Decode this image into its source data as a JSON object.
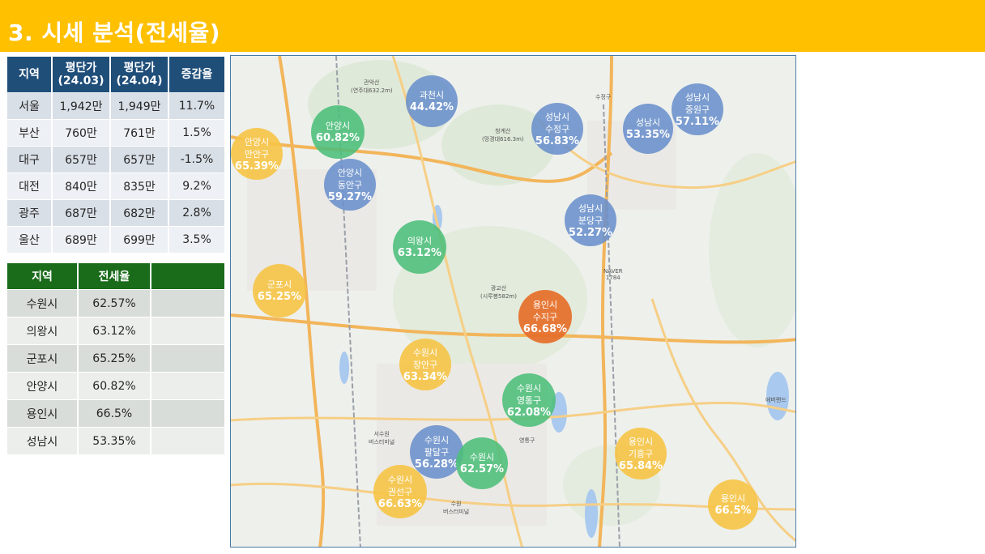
{
  "header": {
    "title": "3. 시세 분석(전세율)"
  },
  "price_table": {
    "headers": [
      "지역",
      "평단가\n(24.03)",
      "평단가\n(24.04)",
      "증감율"
    ],
    "rows": [
      [
        "서울",
        "1,942만",
        "1,949만",
        "11.7%"
      ],
      [
        "부산",
        "760만",
        "761만",
        "1.5%"
      ],
      [
        "대구",
        "657만",
        "657만",
        "-1.5%"
      ],
      [
        "대전",
        "840만",
        "835만",
        "9.2%"
      ],
      [
        "광주",
        "687만",
        "682만",
        "2.8%"
      ],
      [
        "울산",
        "689만",
        "699만",
        "3.5%"
      ]
    ]
  },
  "jeonse_table": {
    "headers": [
      "지역",
      "전세율",
      ""
    ],
    "rows": [
      [
        "수원시",
        "62.57%",
        ""
      ],
      [
        "의왕시",
        "63.12%",
        ""
      ],
      [
        "군포시",
        "65.25%",
        ""
      ],
      [
        "안양시",
        "60.82%",
        ""
      ],
      [
        "용인시",
        "66.5%",
        ""
      ],
      [
        "성남시",
        "53.35%",
        ""
      ]
    ]
  },
  "map": {
    "colors": {
      "blue": "#6a8fcc",
      "green": "#4cbe7a",
      "yellow": "#f6c446",
      "orange": "#e66e28"
    },
    "bubbles": [
      {
        "name": "과천시",
        "value": "44.42%",
        "color": "blue"
      },
      {
        "name": "성남시\n중원구",
        "value": "57.11%",
        "color": "blue"
      },
      {
        "name": "성남시\n수정구",
        "value": "56.83%",
        "color": "blue"
      },
      {
        "name": "성남시",
        "value": "53.35%",
        "color": "blue"
      },
      {
        "name": "안양시",
        "value": "60.82%",
        "color": "green"
      },
      {
        "name": "안양시\n만안구",
        "value": "65.39%",
        "color": "yellow"
      },
      {
        "name": "안양시\n동안구",
        "value": "59.27%",
        "color": "blue"
      },
      {
        "name": "성남시\n분당구",
        "value": "52.27%",
        "color": "blue"
      },
      {
        "name": "의왕시",
        "value": "63.12%",
        "color": "green"
      },
      {
        "name": "군포시",
        "value": "65.25%",
        "color": "yellow"
      },
      {
        "name": "용인시\n수지구",
        "value": "66.68%",
        "color": "orange"
      },
      {
        "name": "수원시\n장안구",
        "value": "63.34%",
        "color": "yellow"
      },
      {
        "name": "수원시\n영통구",
        "value": "62.08%",
        "color": "green"
      },
      {
        "name": "수원시\n팔달구",
        "value": "56.28%",
        "color": "blue"
      },
      {
        "name": "수원시",
        "value": "62.57%",
        "color": "green"
      },
      {
        "name": "용인시\n기흥구",
        "value": "65.84%",
        "color": "yellow"
      },
      {
        "name": "수원시\n권선구",
        "value": "66.63%",
        "color": "yellow"
      },
      {
        "name": "용인시",
        "value": "66.5%",
        "color": "yellow"
      }
    ],
    "labels": [
      "관악산\n(연주대632.2m)",
      "청계산\n(망경대616.3m)",
      "광교산\n(시루봉582m)",
      "수정구",
      "NAVER\n1784",
      "영통구",
      "에버랜드",
      "수원\n버스터미널",
      "서수원\n버스터미널"
    ]
  }
}
